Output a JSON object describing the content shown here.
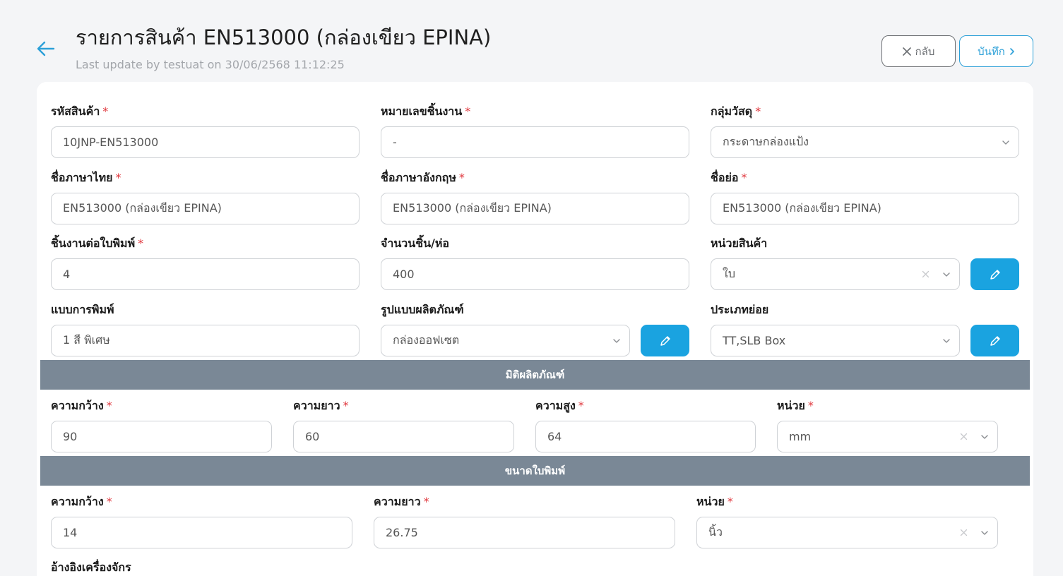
{
  "header": {
    "title": "รายการสินค้า EN513000 (กล่องเขียว EPINA)",
    "last_update": "Last update by testuat on 30/06/2568 11:12:25",
    "back_label": "กลับ",
    "save_label": "บันทึก",
    "required_mark": "*"
  },
  "form": {
    "product_code": {
      "label": "รหัสสินค้า",
      "value": "10JNP-EN513000"
    },
    "part_number": {
      "label": "หมายเลขชิ้นงาน",
      "value": "-"
    },
    "material_group": {
      "label": "กลุ่มวัสดุ",
      "value": "กระดาษกล่องแป้ง"
    },
    "name_th": {
      "label": "ชื่อภาษาไทย",
      "value": "EN513000 (กล่องเขียว EPINA)"
    },
    "name_en": {
      "label": "ชื่อภาษาอังกฤษ",
      "value": "EN513000 (กล่องเขียว EPINA)"
    },
    "short_name": {
      "label": "ชื่อย่อ",
      "value": "EN513000 (กล่องเขียว EPINA)"
    },
    "pieces_per_sheet": {
      "label": "ชิ้นงานต่อใบพิมพ์",
      "value": "4"
    },
    "pieces_per_pack": {
      "label": "จำนวนชิ้น/ห่อ",
      "value": "400"
    },
    "product_unit": {
      "label": "หน่วยสินค้า",
      "value": "ใบ"
    },
    "print_type": {
      "label": "แบบการพิมพ์",
      "value": "1 สี พิเศษ"
    },
    "product_format": {
      "label": "รูปแบบผลิตภัณฑ์",
      "value": "กล่องออฟเซต"
    },
    "sub_type": {
      "label": "ประเภทย่อย",
      "value": "TT,SLB Box"
    }
  },
  "dimensions": {
    "title": "มิติผลิตภัณฑ์",
    "width": {
      "label": "ความกว้าง",
      "value": "90"
    },
    "length": {
      "label": "ความยาว",
      "value": "60"
    },
    "height": {
      "label": "ความสูง",
      "value": "64"
    },
    "unit": {
      "label": "หน่วย",
      "value": "mm"
    }
  },
  "sheet_size": {
    "title": "ขนาดใบพิมพ์",
    "width": {
      "label": "ความกว้าง",
      "value": "14"
    },
    "length": {
      "label": "ความยาว",
      "value": "26.75"
    },
    "unit": {
      "label": "หน่วย",
      "value": "นิ้ว"
    }
  },
  "machine_ref": {
    "label": "อ้างอิงเครื่องจักร"
  },
  "icons": {
    "back": "arrow-left-icon",
    "close": "close-icon",
    "save_chevron": "chevron-right-icon",
    "dropdown": "chevron-down-icon",
    "edit": "pencil-icon",
    "clear": "clear-x-icon"
  },
  "colors": {
    "accent": "#1aa3e0",
    "required": "#e0383e",
    "section_bar": "#7a8896"
  }
}
